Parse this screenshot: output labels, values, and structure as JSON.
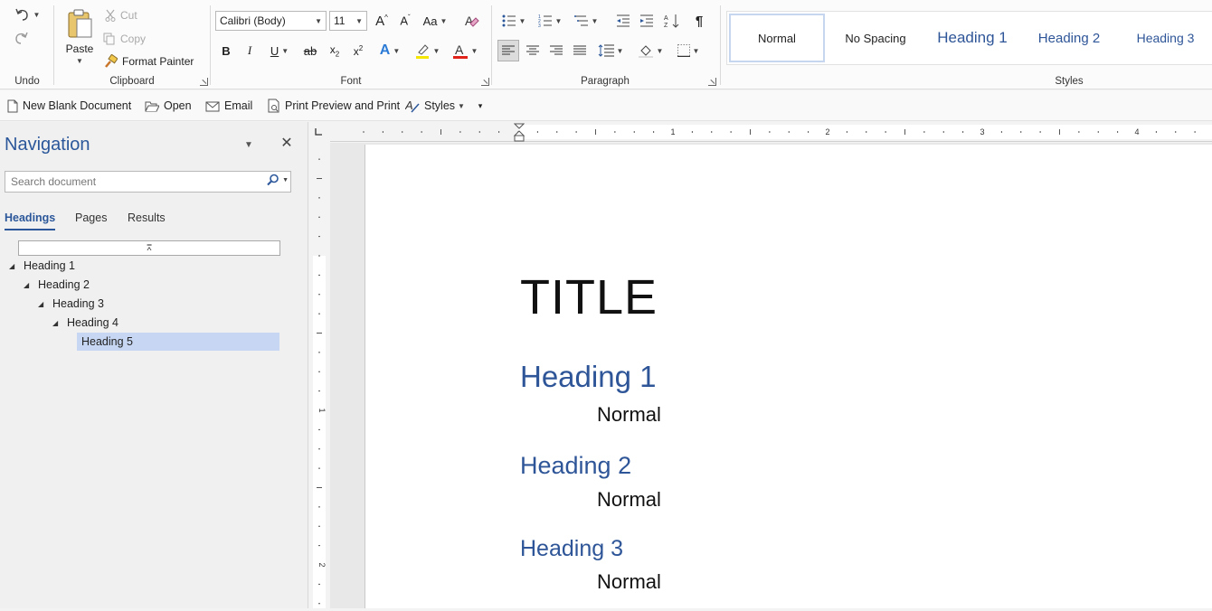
{
  "ribbon": {
    "undo_group": {
      "label": "Undo"
    },
    "clipboard": {
      "label": "Clipboard",
      "paste": "Paste",
      "cut": "Cut",
      "copy": "Copy",
      "format_painter": "Format Painter"
    },
    "font": {
      "label": "Font",
      "font_name": "Calibri (Body)",
      "font_size": "11",
      "case_label": "Aa"
    },
    "paragraph": {
      "label": "Paragraph"
    },
    "styles": {
      "label": "Styles",
      "items": [
        {
          "label": "Normal",
          "color": "#222222"
        },
        {
          "label": "No Spacing",
          "color": "#222222"
        },
        {
          "label": "Heading 1",
          "color": "#2e5597"
        },
        {
          "label": "Heading 2",
          "color": "#2e5597"
        },
        {
          "label": "Heading 3",
          "color": "#2e5597"
        }
      ]
    }
  },
  "quick_access": {
    "new_blank": "New Blank Document",
    "open": "Open",
    "email": "Email",
    "print_preview": "Print Preview and Print",
    "styles": "Styles"
  },
  "navigation": {
    "title": "Navigation",
    "search_placeholder": "Search document",
    "tabs": [
      {
        "label": "Headings",
        "active": true
      },
      {
        "label": "Pages",
        "active": false
      },
      {
        "label": "Results",
        "active": false
      }
    ],
    "tree": [
      {
        "label": "Heading 1",
        "level": 1,
        "selected": false
      },
      {
        "label": "Heading 2",
        "level": 2,
        "selected": false
      },
      {
        "label": "Heading 3",
        "level": 3,
        "selected": false
      },
      {
        "label": "Heading 4",
        "level": 4,
        "selected": false
      },
      {
        "label": "Heading 5",
        "level": 5,
        "selected": true
      }
    ]
  },
  "ruler": {
    "h_numbers": [
      "1",
      "2",
      "3",
      "4"
    ],
    "v_numbers": [
      "1",
      "2"
    ]
  },
  "document": {
    "title": "TITLE",
    "heading1": "Heading 1",
    "normal1": "Normal",
    "heading2": "Heading 2",
    "normal2": "Normal",
    "heading3": "Heading 3",
    "normal3": "Normal"
  },
  "colors": {
    "accent": "#2b579a",
    "heading": "#2e5597",
    "selection": "#c6d6f3"
  }
}
